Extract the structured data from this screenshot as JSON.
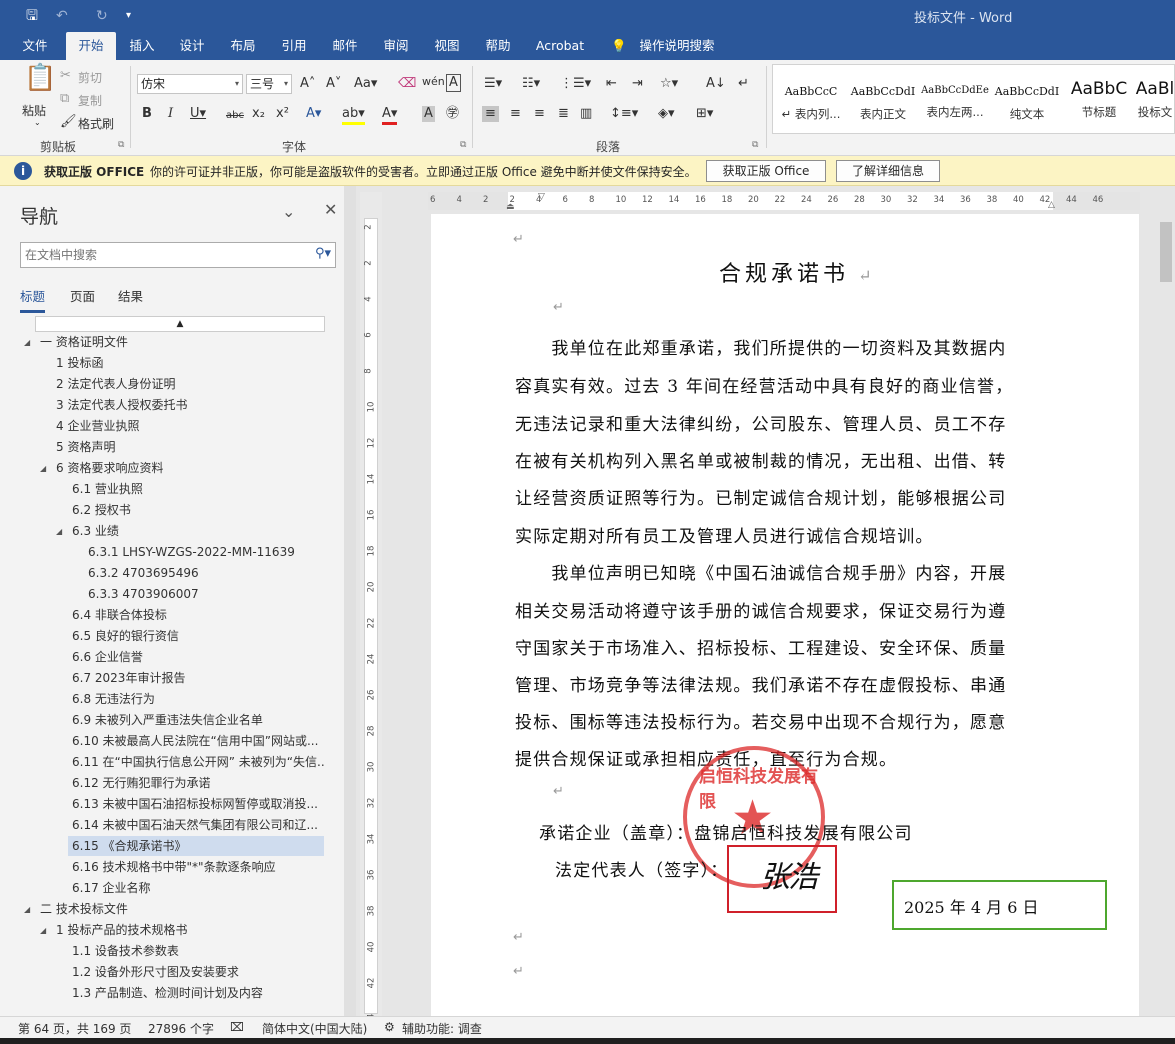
{
  "titlebar": {
    "doc_title": "投标文件  -  Word"
  },
  "tabs": [
    {
      "label": "文件"
    },
    {
      "label": "开始"
    },
    {
      "label": "插入"
    },
    {
      "label": "设计"
    },
    {
      "label": "布局"
    },
    {
      "label": "引用"
    },
    {
      "label": "邮件"
    },
    {
      "label": "审阅"
    },
    {
      "label": "视图"
    },
    {
      "label": "帮助"
    },
    {
      "label": "Acrobat"
    },
    {
      "label": "操作说明搜索"
    }
  ],
  "ribbon": {
    "clipboard": {
      "paste": "粘贴",
      "cut": "剪切",
      "copy": "复制",
      "format_painter": "格式刷",
      "group": "剪贴板"
    },
    "font": {
      "name": "仿宋",
      "size": "三号",
      "group": "字体"
    },
    "paragraph": {
      "group": "段落"
    },
    "styles": [
      {
        "sample": "AaBbCcC",
        "name": "↵ 表内列..."
      },
      {
        "sample": "AaBbCcDdI",
        "name": "表内正文"
      },
      {
        "sample": "AaBbCcDdEe",
        "name": "表内左两..."
      },
      {
        "sample": "AaBbCcDdI",
        "name": "纯文本"
      },
      {
        "sample": "AaBbC",
        "name": "节标题"
      },
      {
        "sample": "AaBl",
        "name": "投标文"
      }
    ]
  },
  "warning": {
    "title": "获取正版 OFFICE",
    "message": "你的许可证并非正版，你可能是盗版软件的受害者。立即通过正版 Office 避免中断并使文件保持安全。",
    "btn_get": "获取正版 Office",
    "btn_more": "了解详细信息"
  },
  "nav": {
    "title": "导航",
    "search_placeholder": "在文档中搜索",
    "tabs": [
      "标题",
      "页面",
      "结果"
    ],
    "items": [
      {
        "label": "一 资格证明文件"
      },
      {
        "label": "1 投标函"
      },
      {
        "label": "2 法定代表人身份证明"
      },
      {
        "label": "3 法定代表人授权委托书"
      },
      {
        "label": "4 企业营业执照"
      },
      {
        "label": "5 资格声明"
      },
      {
        "label": "6 资格要求响应资料"
      },
      {
        "label": "6.1 营业执照"
      },
      {
        "label": "6.2 授权书"
      },
      {
        "label": "6.3 业绩"
      },
      {
        "label": "6.3.1 LHSY-WZGS-2022-MM-11639"
      },
      {
        "label": "6.3.2 4703695496"
      },
      {
        "label": "6.3.3 4703906007"
      },
      {
        "label": "6.4 非联合体投标"
      },
      {
        "label": "6.5 良好的银行资信"
      },
      {
        "label": "6.6 企业信誉"
      },
      {
        "label": "6.7 2023年审计报告"
      },
      {
        "label": "6.8 无违法行为"
      },
      {
        "label": "6.9 未被列入严重违法失信企业名单"
      },
      {
        "label": "6.10 未被最高人民法院在“信用中国”网站或..."
      },
      {
        "label": "6.11 在“中国执行信息公开网” 未被列为“失信..."
      },
      {
        "label": "6.12 无行贿犯罪行为承诺"
      },
      {
        "label": "6.13 未被中国石油招标投标网暂停或取消投..."
      },
      {
        "label": "6.14 未被中国石油天然气集团有限公司和辽..."
      },
      {
        "label": "6.15 《合规承诺书》"
      },
      {
        "label": "6.16 技术规格书中带\"*\"条款逐条响应"
      },
      {
        "label": "6.17 企业名称"
      },
      {
        "label": "二 技术投标文件"
      },
      {
        "label": "1 投标产品的技术规格书"
      },
      {
        "label": "1.1 设备技术参数表"
      },
      {
        "label": "1.2 设备外形尺寸图及安装要求"
      },
      {
        "label": "1.3  产品制造、检测时间计划及内容"
      }
    ]
  },
  "ruler": [
    "6",
    "4",
    "2",
    "2",
    "4",
    "6",
    "8",
    "10",
    "12",
    "14",
    "16",
    "18",
    "20",
    "22",
    "24",
    "26",
    "28",
    "30",
    "32",
    "34",
    "36",
    "38",
    "40",
    "42",
    "44",
    "46"
  ],
  "vruler": [
    "2",
    "2",
    "4",
    "6",
    "8",
    "10",
    "12",
    "14",
    "16",
    "18",
    "20",
    "22",
    "24",
    "26",
    "28",
    "30",
    "32",
    "34",
    "36",
    "38",
    "40",
    "42",
    "44"
  ],
  "document": {
    "title": "合规承诺书",
    "lines": [
      "　　我单位在此郑重承诺，我们所提供的一切资料及其数据内",
      "容真实有效。过去 3 年间在经营活动中具有良好的商业信誉，",
      "无违法记录和重大法律纠纷，公司股东、管理人员、员工不存",
      "在被有关机构列入黑名单或被制裁的情况，无出租、出借、转",
      "让经营资质证照等行为。已制定诚信合规计划，能够根据公司",
      "实际定期对所有员工及管理人员进行诚信合规培训。",
      "　　我单位声明已知晓《中国石油诚信合规手册》内容，开展",
      "相关交易活动将遵守该手册的诚信合规要求，保证交易行为遵",
      "守国家关于市场准入、招标投标、工程建设、安全环保、质量",
      "管理、市场竞争等法律法规。我们承诺不存在虚假投标、串通",
      "投标、围标等违法投标行为。若交易中出现不合规行为，愿意",
      "提供合规保证或承担相应责任，直至行为合规。"
    ],
    "promise_company": "承诺企业（盖章）：盘锦启恒科技发展有限公司",
    "legal_rep": "法定代表人（签字）：",
    "signature": "张浩",
    "date": "2025 年 4 月 6 日",
    "seal_text": "盘锦启恒科技发展有限公司"
  },
  "status": {
    "page": "第 64 页，共 169 页",
    "words": "27896 个字",
    "lang": "简体中文(中国大陆)",
    "accessibility": "辅助功能: 调查"
  }
}
